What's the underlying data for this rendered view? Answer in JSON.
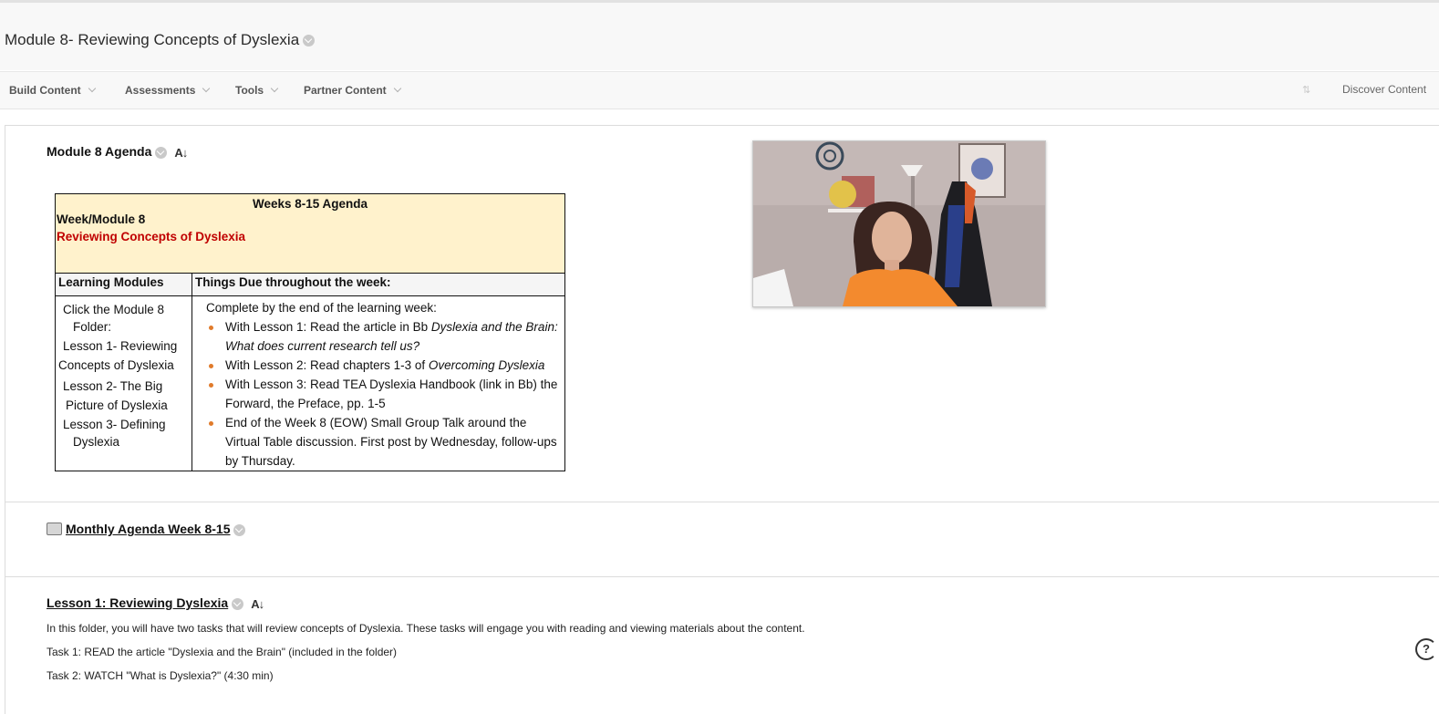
{
  "page": {
    "title": "Module 8- Reviewing Concepts of Dyslexia"
  },
  "toolbar": {
    "build_content": "Build Content",
    "assessments": "Assessments",
    "tools": "Tools",
    "partner_content": "Partner Content",
    "discover_content": "Discover Content"
  },
  "items": {
    "agenda_title": "Module 8 Agenda",
    "a_down_glyph": "A↓",
    "table": {
      "head_title": "Weeks 8-15 Agenda",
      "week": "Week/Module 8",
      "subtitle": "Reviewing Concepts of Dyslexia",
      "col1_header": "Learning Modules",
      "col2_header": "Things Due throughout the week:",
      "modules": [
        "Click the Module 8",
        "Folder:",
        "Lesson 1- Reviewing",
        "Concepts of Dyslexia",
        "Lesson 2- The Big",
        "Picture of Dyslexia",
        "Lesson 3- Defining",
        "Dyslexia"
      ],
      "due_intro": "Complete by the end of the learning week:",
      "due_items": [
        {
          "prefix": "With Lesson 1: Read the article in Bb ",
          "italic": "Dyslexia and the Brain: What does current research tell us?",
          "suffix": ""
        },
        {
          "prefix": "With Lesson 2: Read chapters 1-3 of ",
          "italic": "Overcoming Dyslexia",
          "suffix": ""
        },
        {
          "prefix": "With Lesson 3: Read TEA Dyslexia Handbook (link in Bb) the Forward, the Preface, pp. 1-5",
          "italic": "",
          "suffix": ""
        },
        {
          "prefix": "End of the Week 8 (EOW) Small Group Talk around the Virtual Table discussion. First post by Wednesday, follow-ups by Thursday.",
          "italic": "",
          "suffix": ""
        }
      ]
    },
    "monthly_agenda": "Monthly Agenda Week 8-15",
    "lesson1_title": "Lesson 1: Reviewing Dyslexia",
    "lesson1_desc": "In this folder, you will have two tasks that will review concepts of Dyslexia. These tasks will engage you with reading and viewing materials about the content.",
    "task1": "Task 1: READ the article \"Dyslexia and the Brain\" (included in the folder)",
    "task2": "Task 2: WATCH \"What is Dyslexia?\" (4:30 min)"
  },
  "icons": {
    "chevron": "chevron-down-icon",
    "sort": "sort-arrows-icon",
    "file": "file-icon",
    "help": "help-question-icon"
  },
  "colors": {
    "table_head_bg": "#fff2cc",
    "subtitle_red": "#c00000",
    "bullet_orange": "#e07b2b"
  }
}
